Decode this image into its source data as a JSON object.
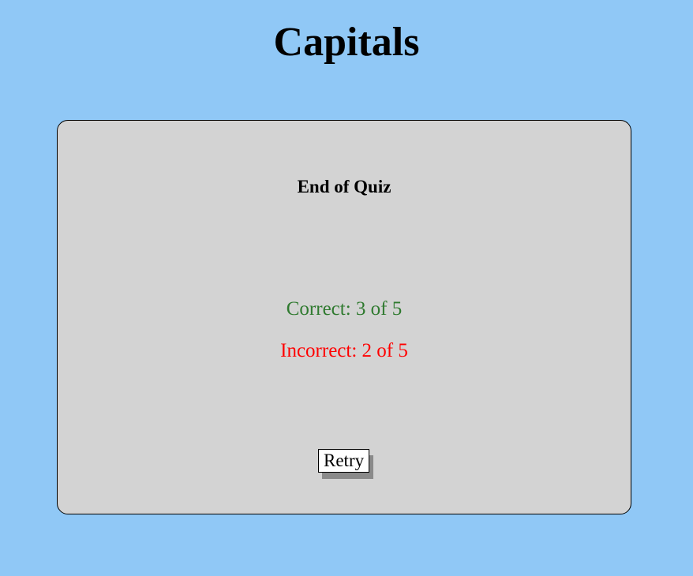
{
  "header": {
    "title": "Capitals"
  },
  "quiz": {
    "heading": "End of Quiz",
    "correct_text": "Correct: 3 of 5",
    "incorrect_text": "Incorrect: 2 of 5",
    "retry_label": "Retry"
  },
  "colors": {
    "background": "#90c8f6",
    "card": "#d3d3d3",
    "correct": "#2f7a2f",
    "incorrect": "#ff0000"
  }
}
